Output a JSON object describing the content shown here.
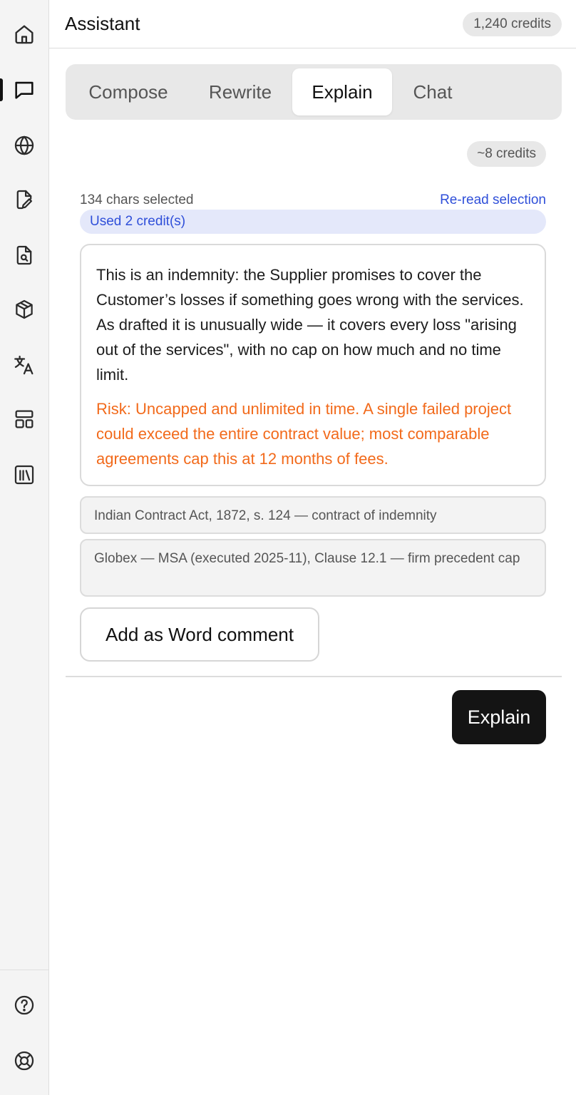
{
  "sidebar": {
    "items": [
      {
        "id": "home",
        "icon": "home-icon"
      },
      {
        "id": "assistant",
        "icon": "chat-bubble-icon",
        "active": true
      },
      {
        "id": "web",
        "icon": "globe-icon"
      },
      {
        "id": "draft",
        "icon": "document-edit-icon"
      },
      {
        "id": "review",
        "icon": "document-search-icon"
      },
      {
        "id": "packages",
        "icon": "cube-icon"
      },
      {
        "id": "translate",
        "icon": "translate-icon"
      },
      {
        "id": "templates",
        "icon": "layout-icon"
      },
      {
        "id": "library",
        "icon": "library-icon"
      }
    ],
    "bottom_items": [
      {
        "id": "help",
        "icon": "help-circle-icon"
      },
      {
        "id": "support",
        "icon": "lifebuoy-icon"
      }
    ]
  },
  "header": {
    "title": "Assistant",
    "credits": "1,240 credits"
  },
  "tabs": [
    {
      "label": "Compose",
      "active": false
    },
    {
      "label": "Rewrite",
      "active": false
    },
    {
      "label": "Explain",
      "active": true
    },
    {
      "label": "Chat",
      "active": false
    }
  ],
  "estimate": "~8 credits",
  "selection": {
    "count_label": "134 chars selected",
    "reread_label": "Re-read selection",
    "used_label": "Used 2 credit(s)"
  },
  "explanation": {
    "body": "This is an indemnity: the Supplier promises to cover the Customer’s losses if something goes wrong with the services. As drafted it is unusually wide — it covers every loss \"arising out of the services\", with no cap on how much and no time limit.",
    "risk": "Risk: Uncapped and unlimited in time. A single failed project could exceed the entire contract value; most comparable agreements cap this at 12 months of fees."
  },
  "references": [
    "Indian Contract Act, 1872, s. 124 — contract of indemnity",
    "Globex — MSA (executed 2025-11), Clause 12.1 — firm precedent cap"
  ],
  "actions": {
    "word_comment_label": "Add as Word comment",
    "explain_label": "Explain"
  },
  "colors": {
    "accent_blue": "#2f4fd9",
    "risk_orange": "#f26a1b",
    "primary_button": "#141414"
  }
}
